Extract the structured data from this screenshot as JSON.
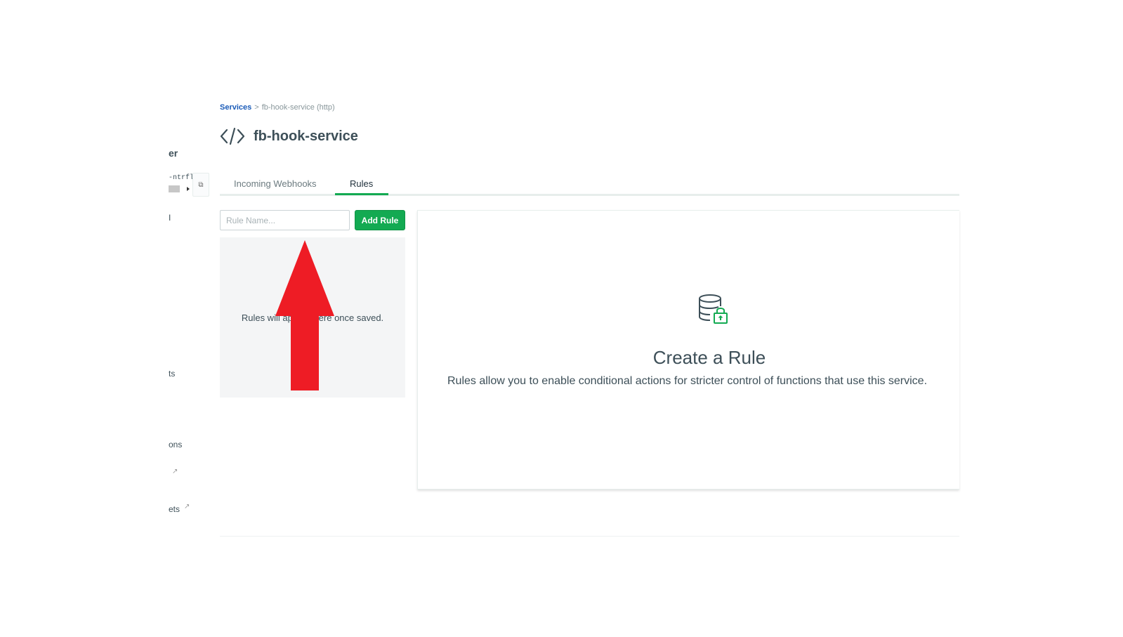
{
  "sidebar": {
    "fragments": {
      "heading": "er",
      "cluster_code": "-ntrfl",
      "item_1": "I",
      "item_2": "ts",
      "item_3": "ons",
      "item_4": "ets"
    }
  },
  "breadcrumb": {
    "root": "Services",
    "separator": ">",
    "current": "fb-hook-service (http)"
  },
  "header": {
    "title": "fb-hook-service",
    "icon": "code-icon"
  },
  "tabs": [
    {
      "label": "Incoming Webhooks",
      "active": false
    },
    {
      "label": "Rules",
      "active": true
    }
  ],
  "rules": {
    "input_placeholder": "Rule Name...",
    "add_label": "Add Rule",
    "empty_text": "Rules will appear here once saved."
  },
  "create_panel": {
    "icon": "database-lock-icon",
    "title": "Create a Rule",
    "description": "Rules allow you to enable conditional actions for stricter control of functions that use this service."
  },
  "colors": {
    "primary_green": "#13aa52",
    "link_blue": "#1a5bb8",
    "annotation_red": "#ee1c25"
  }
}
